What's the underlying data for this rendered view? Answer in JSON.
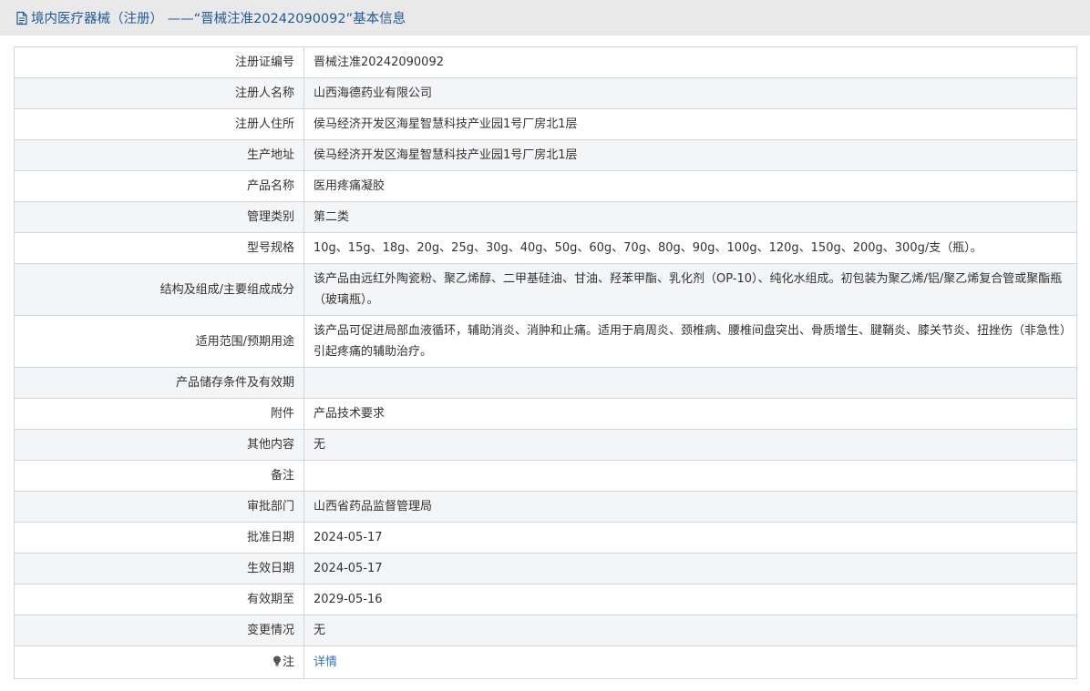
{
  "header": {
    "title": "境内医疗器械（注册） ——“晋械注准20242090092”基本信息",
    "icon": "document-icon",
    "color": "#1f5a9a"
  },
  "rows": [
    {
      "label": "注册证编号",
      "value": "晋械注准20242090092"
    },
    {
      "label": "注册人名称",
      "value": "山西海德药业有限公司"
    },
    {
      "label": "注册人住所",
      "value": "侯马经济开发区海星智慧科技产业园1号厂房北1层"
    },
    {
      "label": "生产地址",
      "value": "侯马经济开发区海星智慧科技产业园1号厂房北1层"
    },
    {
      "label": "产品名称",
      "value": "医用疼痛凝胶"
    },
    {
      "label": "管理类别",
      "value": "第二类"
    },
    {
      "label": "型号规格",
      "value": "10g、15g、18g、20g、25g、30g、40g、50g、60g、70g、80g、90g、100g、120g、150g、200g、300g/支（瓶）。"
    },
    {
      "label": "结构及组成/主要组成成分",
      "value": "该产品由远红外陶瓷粉、聚乙烯醇、二甲基硅油、甘油、羟苯甲酯、乳化剂（OP-10）、纯化水组成。初包装为聚乙烯/铝/聚乙烯复合管或聚酯瓶（玻璃瓶）。"
    },
    {
      "label": "适用范围/预期用途",
      "value": "该产品可促进局部血液循环，辅助消炎、消肿和止痛。适用于肩周炎、颈椎病、腰椎间盘突出、骨质增生、腱鞘炎、膝关节炎、扭挫伤（非急性）引起疼痛的辅助治疗。"
    },
    {
      "label": "产品储存条件及有效期",
      "value": ""
    },
    {
      "label": "附件",
      "value": "产品技术要求"
    },
    {
      "label": "其他内容",
      "value": "无"
    },
    {
      "label": "备注",
      "value": ""
    },
    {
      "label": "审批部门",
      "value": "山西省药品监督管理局"
    },
    {
      "label": "批准日期",
      "value": "2024-05-17"
    },
    {
      "label": "生效日期",
      "value": "2024-05-17"
    },
    {
      "label": "有效期至",
      "value": "2029-05-16"
    },
    {
      "label": "变更情况",
      "value": "无"
    }
  ],
  "note_row": {
    "icon": "lightbulb-icon",
    "label": "注",
    "link_text": "详情",
    "link_color": "#2a77b8"
  }
}
